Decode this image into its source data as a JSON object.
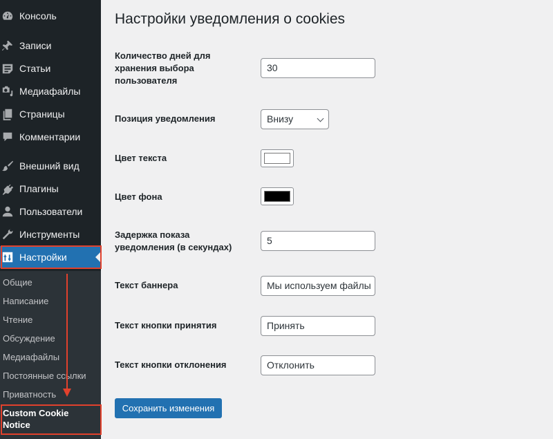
{
  "sidebar": {
    "items": [
      {
        "label": "Консоль",
        "icon": "dashboard-icon"
      },
      {
        "label": "Записи",
        "icon": "pin-icon"
      },
      {
        "label": "Статьи",
        "icon": "article-icon"
      },
      {
        "label": "Медиафайлы",
        "icon": "media-icon"
      },
      {
        "label": "Страницы",
        "icon": "pages-icon"
      },
      {
        "label": "Комментарии",
        "icon": "comment-icon"
      },
      {
        "label": "Внешний вид",
        "icon": "brush-icon"
      },
      {
        "label": "Плагины",
        "icon": "plugin-icon"
      },
      {
        "label": "Пользователи",
        "icon": "user-icon"
      },
      {
        "label": "Инструменты",
        "icon": "wrench-icon"
      },
      {
        "label": "Настройки",
        "icon": "settings-icon",
        "active": true
      }
    ],
    "submenu": [
      {
        "label": "Общие"
      },
      {
        "label": "Написание"
      },
      {
        "label": "Чтение"
      },
      {
        "label": "Обсуждение"
      },
      {
        "label": "Медиафайлы"
      },
      {
        "label": "Постоянные ссылки"
      },
      {
        "label": "Приватность"
      },
      {
        "label": "Custom Cookie Notice",
        "current": true
      }
    ]
  },
  "page": {
    "title": "Настройки уведомления о cookies",
    "fields": {
      "days": {
        "label": "Количество дней для хранения выбора пользователя",
        "value": "30"
      },
      "position": {
        "label": "Позиция уведомления",
        "value": "Внизу"
      },
      "text_color": {
        "label": "Цвет текста",
        "value": "#ffffff"
      },
      "bg_color": {
        "label": "Цвет фона",
        "value": "#000000"
      },
      "delay": {
        "label": "Задержка показа уведомления (в секундах)",
        "value": "5"
      },
      "banner_text": {
        "label": "Текст баннера",
        "value": "Мы используем файлы"
      },
      "accept_text": {
        "label": "Текст кнопки принятия",
        "value": "Принять"
      },
      "decline_text": {
        "label": "Текст кнопки отклонения",
        "value": "Отклонить"
      }
    },
    "save_label": "Сохранить изменения"
  },
  "annotations": {
    "highlight_color": "#e2412c"
  },
  "colors": {
    "accent": "#2271b1",
    "sidebar_bg": "#1d2327",
    "submenu_bg": "#2c3338"
  }
}
